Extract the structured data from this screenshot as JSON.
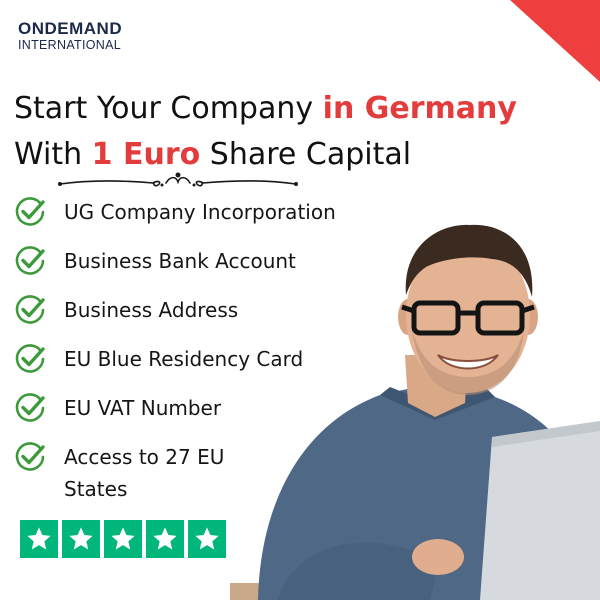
{
  "brand": {
    "name_top": "ONDEMAND",
    "name_bottom": "INTERNATIONAL"
  },
  "headline": {
    "line1_start": "Start Your Company ",
    "line1_highlight": "in Germany",
    "line2_start": "With ",
    "line2_highlight": "1 Euro",
    "line2_end": " Share Capital"
  },
  "features": [
    {
      "label": "UG Company Incorporation"
    },
    {
      "label": "Business Bank Account"
    },
    {
      "label": "Business Address"
    },
    {
      "label": "EU Blue Residency Card"
    },
    {
      "label": "EU VAT Number"
    },
    {
      "label": "Access to 27 EU States"
    }
  ],
  "rating": {
    "stars": 5,
    "max_stars": 5
  },
  "colors": {
    "accent_red": "#e23c3c",
    "corner_red": "#ef3e3e",
    "check_green": "#3d9a3b",
    "star_green": "#00b67a",
    "logo_navy": "#1b2a4a"
  },
  "icons": {
    "feature_icon": "check-circle-icon",
    "rating_icon": "star-icon"
  }
}
